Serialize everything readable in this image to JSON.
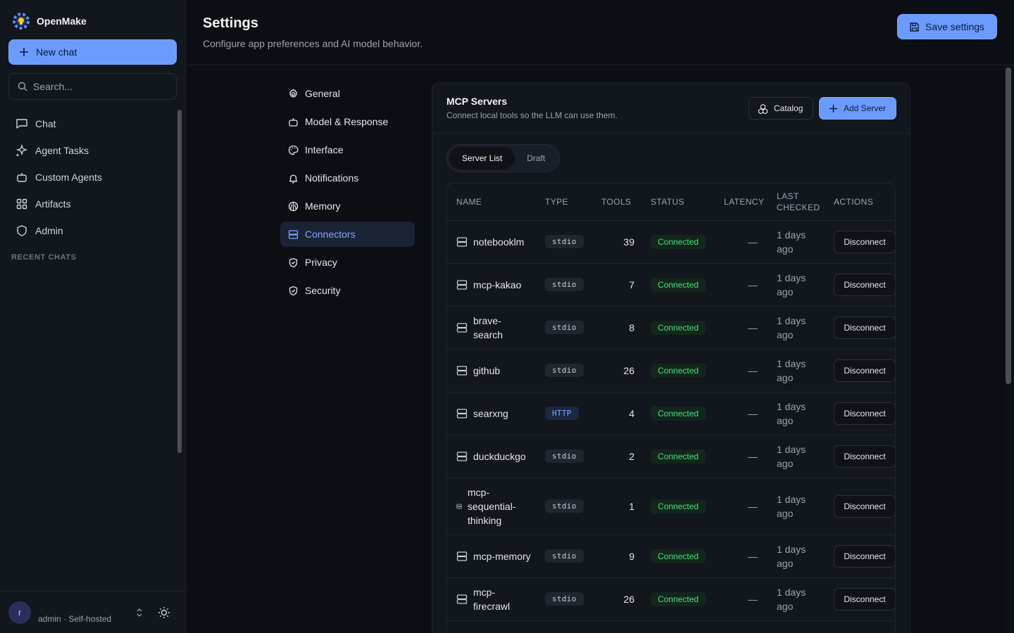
{
  "app": {
    "name": "OpenMake"
  },
  "sidebar": {
    "new_chat_label": "New chat",
    "search_placeholder": "Search...",
    "items": [
      {
        "label": "Chat",
        "icon": "chat-icon"
      },
      {
        "label": "Agent Tasks",
        "icon": "sparkles-icon"
      },
      {
        "label": "Custom Agents",
        "icon": "bot-icon"
      },
      {
        "label": "Artifacts",
        "icon": "grid-icon"
      },
      {
        "label": "Admin",
        "icon": "shield-icon"
      }
    ],
    "recent_label": "RECENT CHATS",
    "recent_chats": [
      "",
      "",
      "",
      "",
      "",
      "",
      "",
      "",
      "",
      "",
      "",
      "",
      "",
      ""
    ]
  },
  "user": {
    "avatar_initial": "r",
    "email": "",
    "role": "admin · Self-hosted"
  },
  "header": {
    "title": "Settings",
    "subtitle": "Configure app preferences and AI model behavior.",
    "save_label": "Save settings"
  },
  "settings_nav": [
    {
      "label": "General",
      "icon": "gear-icon"
    },
    {
      "label": "Model & Response",
      "icon": "bot-icon"
    },
    {
      "label": "Interface",
      "icon": "palette-icon"
    },
    {
      "label": "Notifications",
      "icon": "bell-icon"
    },
    {
      "label": "Memory",
      "icon": "brain-icon"
    },
    {
      "label": "Connectors",
      "icon": "server-icon",
      "active": true
    },
    {
      "label": "Privacy",
      "icon": "shield-check-icon"
    },
    {
      "label": "Security",
      "icon": "shield-check-icon"
    }
  ],
  "panel": {
    "title": "MCP Servers",
    "subtitle": "Connect local tools so the LLM can use them.",
    "catalog_label": "Catalog",
    "add_label": "Add Server",
    "tabs": [
      "Server List",
      "Draft"
    ],
    "columns": {
      "name": "NAME",
      "type": "TYPE",
      "tools": "TOOLS",
      "status": "STATUS",
      "latency": "LATENCY",
      "last_checked": "LAST CHECKED",
      "actions": "ACTIONS"
    },
    "rows": [
      {
        "name": "notebooklm",
        "type": "stdio",
        "tools": "39",
        "status": "Connected",
        "latency": "—",
        "last_checked": "1 days ago",
        "action": "Disconnect"
      },
      {
        "name": "mcp-kakao",
        "type": "stdio",
        "tools": "7",
        "status": "Connected",
        "latency": "—",
        "last_checked": "1 days ago",
        "action": "Disconnect"
      },
      {
        "name": "brave-search",
        "type": "stdio",
        "tools": "8",
        "status": "Connected",
        "latency": "—",
        "last_checked": "1 days ago",
        "action": "Disconnect"
      },
      {
        "name": "github",
        "type": "stdio",
        "tools": "26",
        "status": "Connected",
        "latency": "—",
        "last_checked": "1 days ago",
        "action": "Disconnect"
      },
      {
        "name": "searxng",
        "type": "HTTP",
        "tools": "4",
        "status": "Connected",
        "latency": "—",
        "last_checked": "1 days ago",
        "action": "Disconnect"
      },
      {
        "name": "duckduckgo",
        "type": "stdio",
        "tools": "2",
        "status": "Connected",
        "latency": "—",
        "last_checked": "1 days ago",
        "action": "Disconnect"
      },
      {
        "name": "mcp-sequential-thinking",
        "type": "stdio",
        "tools": "1",
        "status": "Connected",
        "latency": "—",
        "last_checked": "1 days ago",
        "action": "Disconnect"
      },
      {
        "name": "mcp-memory",
        "type": "stdio",
        "tools": "9",
        "status": "Connected",
        "latency": "—",
        "last_checked": "1 days ago",
        "action": "Disconnect"
      },
      {
        "name": "mcp-firecrawl",
        "type": "stdio",
        "tools": "26",
        "status": "Connected",
        "latency": "—",
        "last_checked": "1 days ago",
        "action": "Disconnect"
      }
    ]
  },
  "colors": {
    "accent": "#6b9bff",
    "success": "#4ade80",
    "background": "#0b0e13",
    "surface": "#12161d"
  }
}
